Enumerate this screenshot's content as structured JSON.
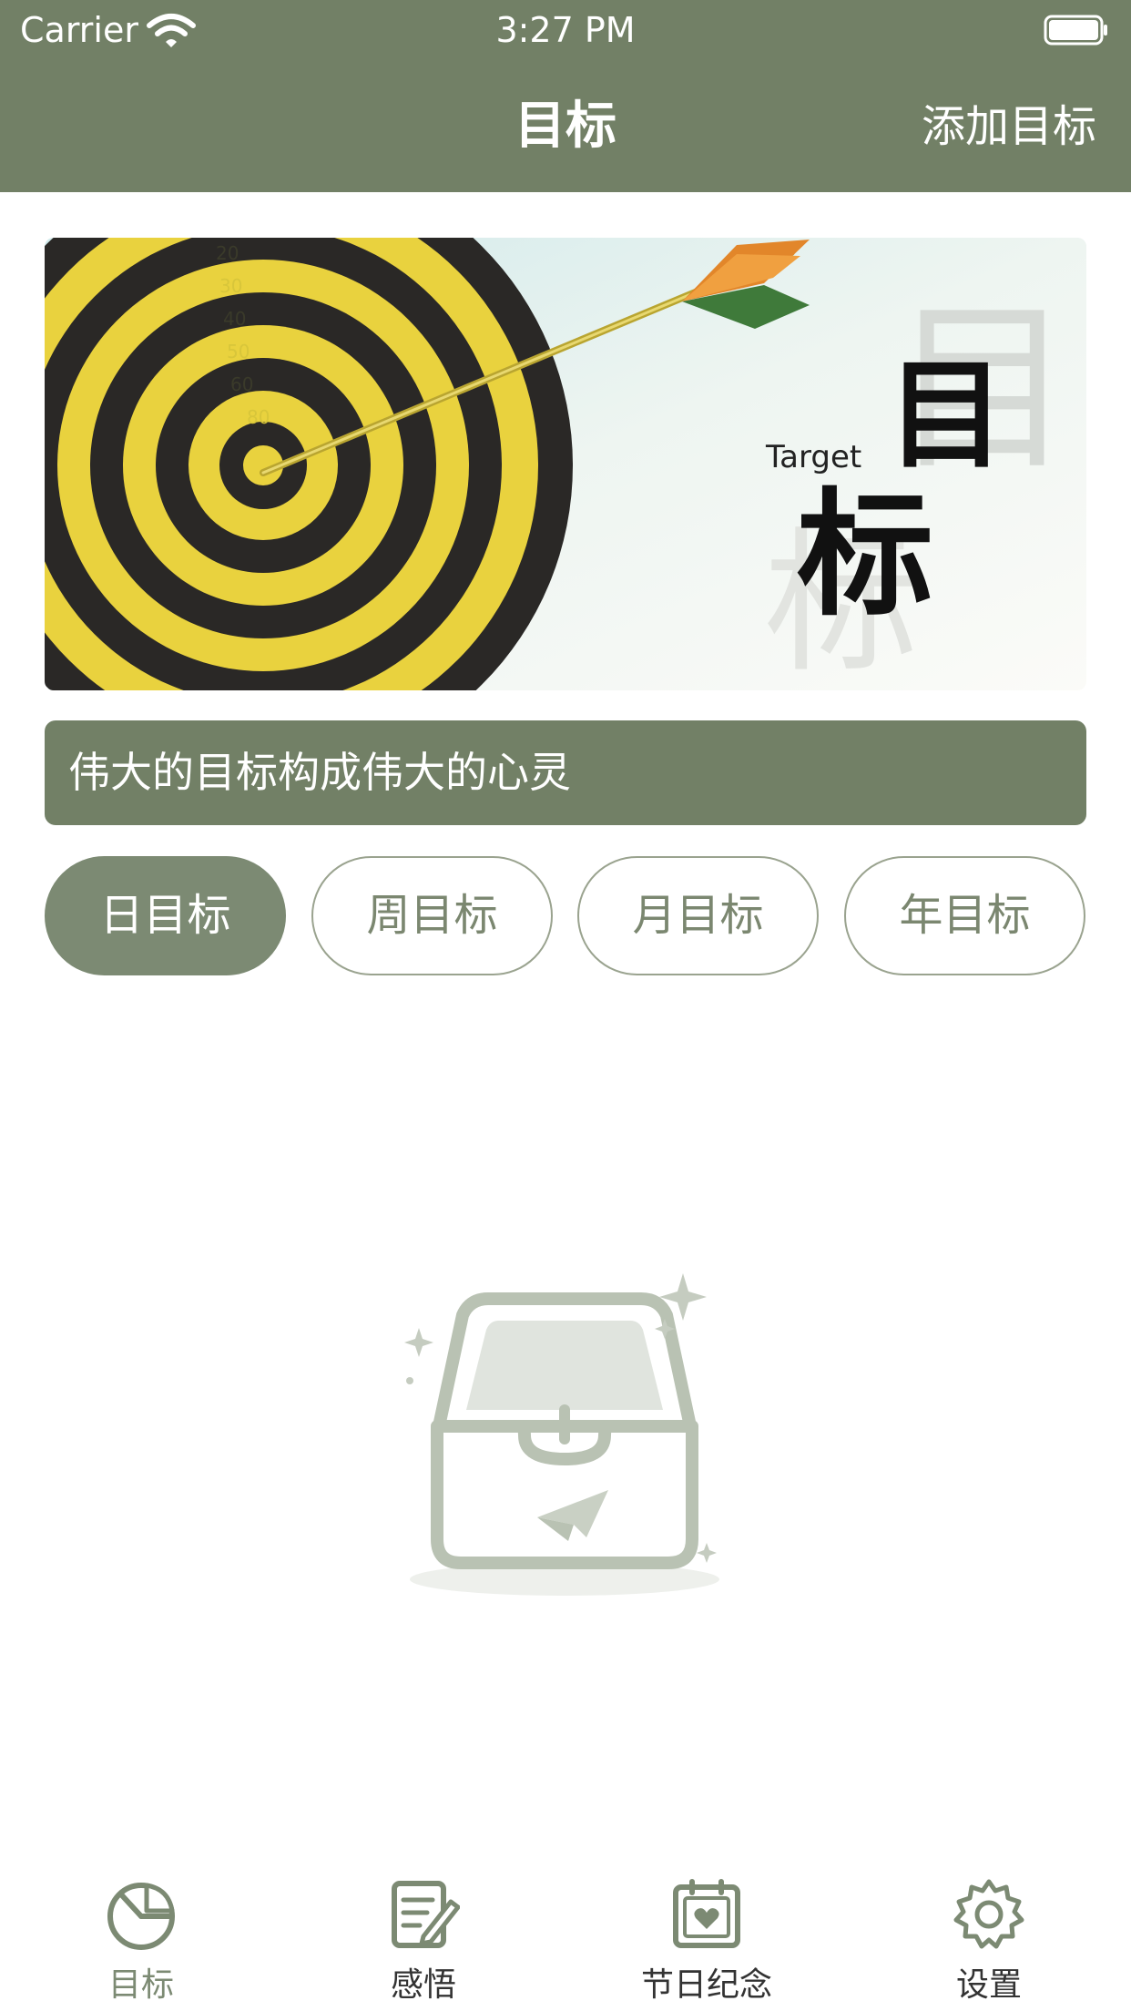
{
  "status_bar": {
    "carrier": "Carrier",
    "time": "3:27 PM"
  },
  "nav": {
    "title": "目标",
    "add_goal": "添加目标"
  },
  "banner": {
    "caption_en": "Target",
    "caption_zh_top": "目",
    "caption_zh_bottom": "标",
    "ring_labels": [
      "20",
      "30",
      "40",
      "50",
      "60",
      "80"
    ]
  },
  "quote": {
    "text": "伟大的目标构成伟大的心灵"
  },
  "period_tabs": [
    {
      "label": "日目标",
      "active": true
    },
    {
      "label": "周目标",
      "active": false
    },
    {
      "label": "月目标",
      "active": false
    },
    {
      "label": "年目标",
      "active": false
    }
  ],
  "tab_bar": {
    "items": [
      {
        "label": "目标",
        "icon": "pie-chart-icon",
        "active": true
      },
      {
        "label": "感悟",
        "icon": "note-edit-icon",
        "active": false
      },
      {
        "label": "节日纪念",
        "icon": "calendar-heart-icon",
        "active": false
      },
      {
        "label": "设置",
        "icon": "gear-icon",
        "active": false
      }
    ]
  },
  "colors": {
    "header": "#728066",
    "accent": "#7c8a73",
    "tab_border": "#9aa38f",
    "tab_text": "#7b8770",
    "empty_icon": "#b9c2b3"
  }
}
